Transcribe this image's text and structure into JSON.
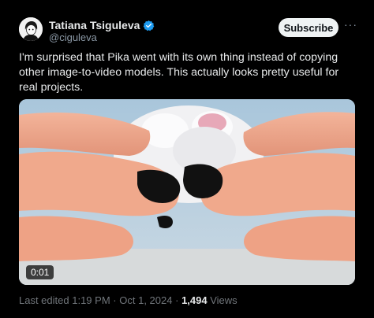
{
  "author": {
    "display_name": "Tatiana Tsiguleva",
    "handle": "@ciguleva",
    "verified_icon": "verified-badge-icon"
  },
  "actions": {
    "subscribe_label": "Subscribe",
    "more_label": "···"
  },
  "tweet": {
    "text": "I'm surprised that Pika went with its own thing instead of copying other image-to-video models. This actually looks pretty useful for real projects."
  },
  "media": {
    "duration": "0:01"
  },
  "meta": {
    "edited_prefix": "Last edited",
    "time": "1:19 PM",
    "separator": "·",
    "date": "Oct 1, 2024",
    "views_count": "1,494",
    "views_label": "Views"
  },
  "colors": {
    "background": "#000000",
    "text": "#e7e9ea",
    "secondary_text": "#71767b",
    "verified_blue": "#1d9bf0",
    "subscribe_bg": "#eff3f4"
  }
}
